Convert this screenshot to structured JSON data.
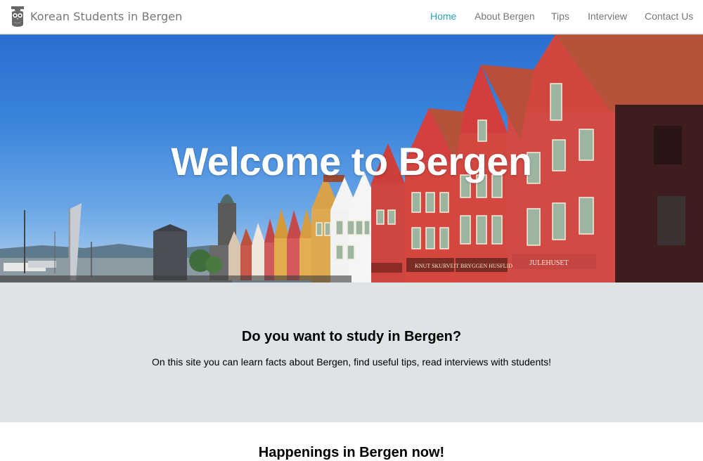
{
  "navbar": {
    "brand": "Korean Students in Bergen",
    "logo_icon": "owl-logo-icon",
    "links": [
      {
        "label": "Home",
        "active": true
      },
      {
        "label": "About Bergen",
        "active": false
      },
      {
        "label": "Tips",
        "active": false
      },
      {
        "label": "Interview",
        "active": false
      },
      {
        "label": "Contact Us",
        "active": false
      }
    ],
    "active_color": "#2aa3b3"
  },
  "hero": {
    "title": "Welcome to Bergen",
    "signs": {
      "sign1": "KNUT SKURVEIT",
      "sign2": "BRYGGEN HUSFLID",
      "sign3": "JULEHUSET"
    }
  },
  "intro": {
    "heading": "Do you want to study in Bergen?",
    "text": "On this site you can learn facts about Bergen, find useful tips, read interviews with students!",
    "background": "#dee3e5"
  },
  "happenings": {
    "heading": "Happenings in Bergen now!"
  }
}
